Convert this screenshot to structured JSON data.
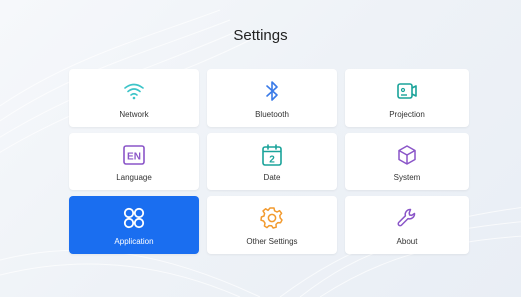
{
  "page": {
    "title": "Settings"
  },
  "tiles": [
    {
      "label": "Network",
      "icon": "wifi-icon"
    },
    {
      "label": "Bluetooth",
      "icon": "bluetooth-icon"
    },
    {
      "label": "Projection",
      "icon": "projection-icon"
    },
    {
      "label": "Language",
      "icon": "language-en-icon",
      "icon_text": "EN"
    },
    {
      "label": "Date",
      "icon": "calendar-icon",
      "icon_text": "2"
    },
    {
      "label": "System",
      "icon": "cube-icon"
    },
    {
      "label": "Application",
      "icon": "apps-icon",
      "selected": true
    },
    {
      "label": "Other Settings",
      "icon": "gear-icon"
    },
    {
      "label": "About",
      "icon": "wrench-icon"
    }
  ],
  "colors": {
    "cyan": "#3cc4c8",
    "blue": "#3a7be8",
    "teal": "#1aa39a",
    "purple": "#8a55c8",
    "orange": "#f29a2e",
    "selected": "#1a6ef0"
  }
}
